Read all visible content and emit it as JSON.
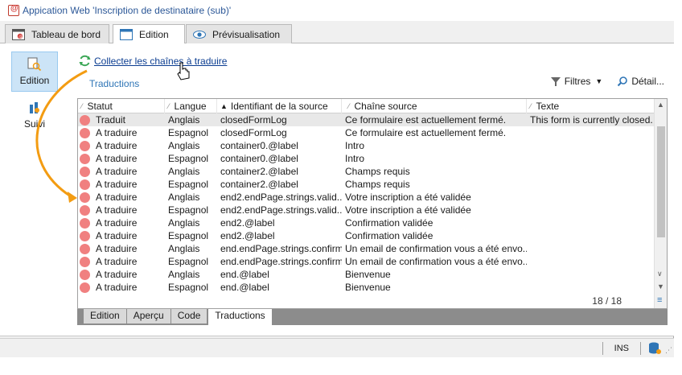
{
  "window": {
    "title": "Appication Web 'Inscription de destinataire (sub)'"
  },
  "tabs": [
    {
      "label": "Tableau de bord",
      "icon": "dashboard-icon"
    },
    {
      "label": "Edition",
      "icon": "window-icon"
    },
    {
      "label": "Prévisualisation",
      "icon": "eye-icon"
    }
  ],
  "leftnav": {
    "edition_label": "Edition",
    "suivi_label": "Suivi"
  },
  "collect_link": "Collecter les chaînes à traduire",
  "section_title": "Traductions",
  "toolbar": {
    "filters_label": "Filtres",
    "detail_label": "Détail..."
  },
  "grid": {
    "columns": [
      "Statut",
      "Langue",
      "Identifiant de la source",
      "Chaîne source",
      "Texte"
    ],
    "rows": [
      {
        "status": "Traduit",
        "lang": "Anglais",
        "id": "closedFormLog",
        "source": "Ce formulaire est actuellement fermé.",
        "text": "This form is currently closed."
      },
      {
        "status": "A traduire",
        "lang": "Espagnol",
        "id": "closedFormLog",
        "source": "Ce formulaire est actuellement fermé.",
        "text": ""
      },
      {
        "status": "A traduire",
        "lang": "Anglais",
        "id": "container0.@label",
        "source": "Intro",
        "text": ""
      },
      {
        "status": "A traduire",
        "lang": "Espagnol",
        "id": "container0.@label",
        "source": "Intro",
        "text": ""
      },
      {
        "status": "A traduire",
        "lang": "Anglais",
        "id": "container2.@label",
        "source": "Champs requis",
        "text": ""
      },
      {
        "status": "A traduire",
        "lang": "Espagnol",
        "id": "container2.@label",
        "source": "Champs requis",
        "text": ""
      },
      {
        "status": "A traduire",
        "lang": "Anglais",
        "id": "end2.endPage.strings.valid...",
        "source": "Votre inscription a été validée",
        "text": ""
      },
      {
        "status": "A traduire",
        "lang": "Espagnol",
        "id": "end2.endPage.strings.valid...",
        "source": "Votre inscription a été validée",
        "text": ""
      },
      {
        "status": "A traduire",
        "lang": "Anglais",
        "id": "end2.@label",
        "source": "Confirmation validée",
        "text": ""
      },
      {
        "status": "A traduire",
        "lang": "Espagnol",
        "id": "end2.@label",
        "source": "Confirmation validée",
        "text": ""
      },
      {
        "status": "A traduire",
        "lang": "Anglais",
        "id": "end.endPage.strings.confirm",
        "source": "Un email de confirmation vous a été envo...",
        "text": ""
      },
      {
        "status": "A traduire",
        "lang": "Espagnol",
        "id": "end.endPage.strings.confirm",
        "source": "Un email de confirmation vous a été envo...",
        "text": ""
      },
      {
        "status": "A traduire",
        "lang": "Anglais",
        "id": "end.@label",
        "source": "Bienvenue",
        "text": ""
      },
      {
        "status": "A traduire",
        "lang": "Espagnol",
        "id": "end.@label",
        "source": "Bienvenue",
        "text": ""
      }
    ],
    "count": "18 / 18"
  },
  "subtabs": [
    "Edition",
    "Aperçu",
    "Code",
    "Traductions"
  ],
  "statusbar": {
    "ins": "INS"
  },
  "colors": {
    "accent": "#2e75b6",
    "status_dot": "#f08080",
    "annotation": "#f39c12",
    "selected_nav": "#cce4f7"
  }
}
